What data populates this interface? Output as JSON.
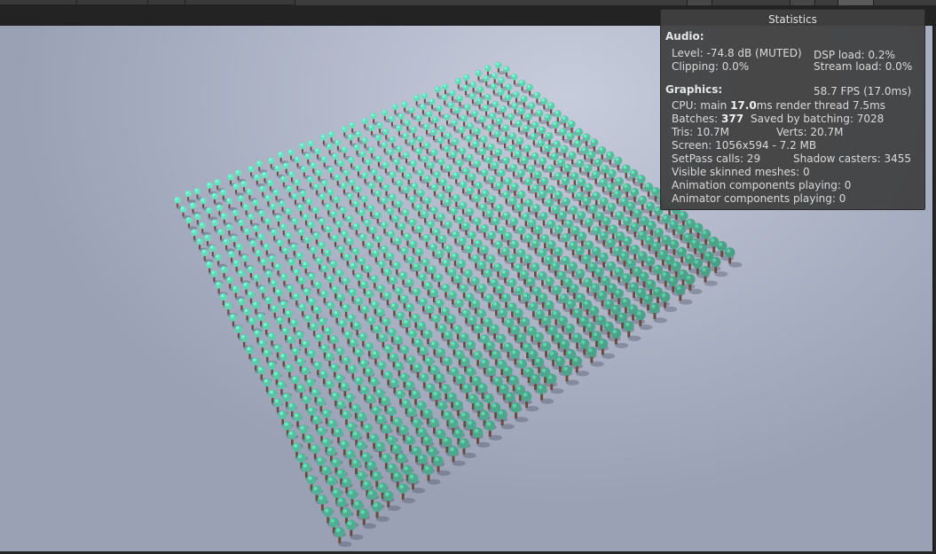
{
  "stats_panel": {
    "title": "Statistics",
    "audio": {
      "heading": "Audio:",
      "level": "Level: -74.8 dB (MUTED)",
      "dsp_load": "DSP load: 0.2%",
      "clipping": "Clipping: 0.0%",
      "stream_load": "Stream load: 0.0%"
    },
    "graphics": {
      "heading": "Graphics:",
      "fps": "58.7 FPS (17.0ms)",
      "cpu_prefix": "CPU: main ",
      "cpu_main_ms": "17.0",
      "cpu_suffix": "ms  render thread 7.5ms",
      "batches_prefix": "Batches: ",
      "batches_value": "377",
      "saved_by_batching": "Saved by batching: 7028",
      "tris": "Tris: 10.7M",
      "verts": "Verts: 20.7M",
      "screen": "Screen: 1056x594 - 7.2 MB",
      "setpass_calls": "SetPass calls: 29",
      "shadow_casters": "Shadow casters: 3455",
      "visible_skinned_meshes": "Visible skinned meshes: 0",
      "animation_components": "Animation components playing: 0",
      "animator_components": "Animator components playing: 0"
    }
  },
  "scene": {
    "grid_rows": 32,
    "grid_cols": 32,
    "tree_canopy_color": "#5fd1ae",
    "tree_trunk_color": "#6a4a3e",
    "ground_color": "#b7bdce"
  }
}
